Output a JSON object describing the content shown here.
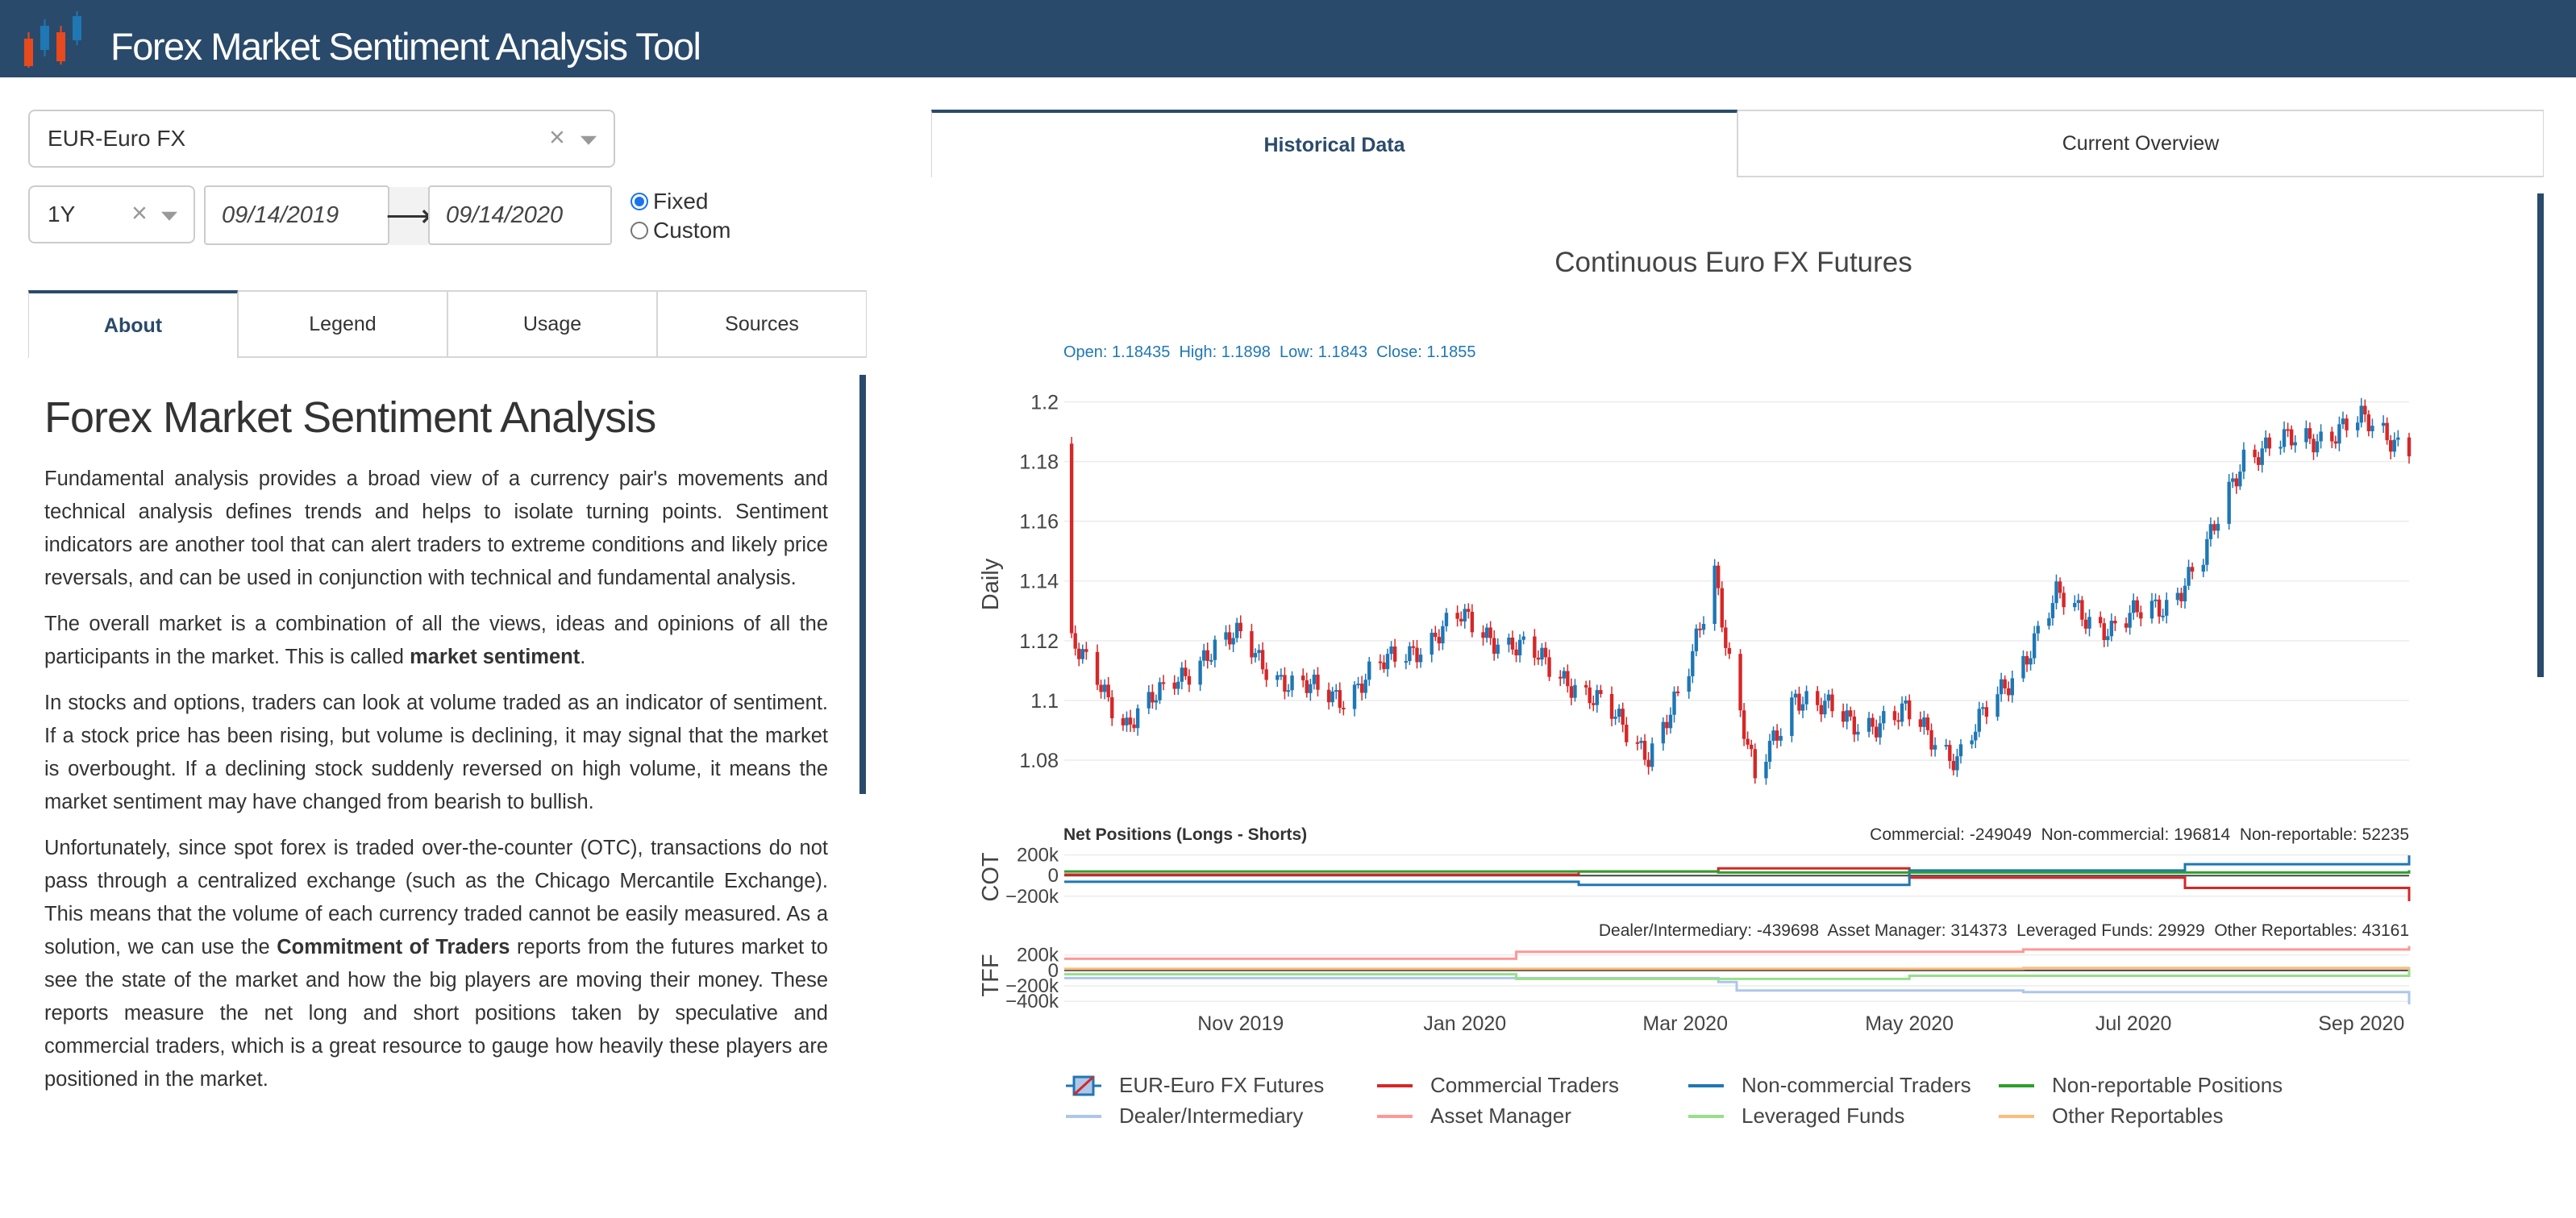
{
  "header": {
    "title": "Forex Market Sentiment Analysis Tool"
  },
  "colors": {
    "header_bg": "#2a4a6b",
    "up_candle": "#1f77b4",
    "down_candle": "#d62728",
    "accent": "#2a4a6b"
  },
  "controls": {
    "currency": "EUR-Euro FX",
    "period": "1Y",
    "start_date": "09/14/2019",
    "end_date": "09/14/2020",
    "radio_fixed": "Fixed",
    "radio_custom": "Custom",
    "selected_radio": "Fixed"
  },
  "left_tabs": [
    "About",
    "Legend",
    "Usage",
    "Sources"
  ],
  "left_active_tab": "About",
  "right_tabs": [
    "Historical Data",
    "Current Overview"
  ],
  "right_active_tab": "Historical Data",
  "about": {
    "heading": "Forex Market Sentiment Analysis",
    "p1": "Fundamental analysis provides a broad view of a currency pair's movements and technical analysis defines trends and helps to isolate turning points. Sentiment indicators are another tool that can alert traders to extreme conditions and likely price reversals, and can be used in conjunction with technical and fundamental analysis.",
    "p2_a": "The overall market is a combination of all the views, ideas and opinions of all the participants in the market. This is called ",
    "p2_b": "market sentiment",
    "p2_c": ".",
    "p3": "In stocks and options, traders can look at volume traded as an indicator of sentiment. If a stock price has been rising, but volume is declining, it may signal that the market is overbought. If a declining stock suddenly reversed on high volume, it means the market sentiment may have changed from bearish to bullish.",
    "p4_a": "Unfortunately, since spot forex is traded over-the-counter (OTC), transactions do not pass through a centralized exchange (such as the Chicago Mercantile Exchange). This means that the volume of each currency traded cannot be easily measured. As a solution, we can use the ",
    "p4_b": "Commitment of Traders",
    "p4_c": " reports from the futures market to see the state of the market and how the big players are moving their money. These reports measure the net long and short positions taken by speculative and commercial traders, which is a great resource to gauge how heavily these players are positioned in the market."
  },
  "chart_data": {
    "type": "line",
    "title": "Continuous Euro FX Futures",
    "ohlc_readout": "Open: 1.18435  High: 1.1898  Low: 1.1843  Close: 1.1855",
    "price_panel": {
      "ylabel": "Daily",
      "yticks": [
        "1.2",
        "1.18",
        "1.16",
        "1.14",
        "1.12",
        "1.1",
        "1.08"
      ],
      "ylim": [
        1.07,
        1.205
      ],
      "close_path": [
        [
          "2019-09-16",
          1.118
        ],
        [
          "2019-10-01",
          1.093
        ],
        [
          "2019-10-10",
          1.101
        ],
        [
          "2019-10-21",
          1.115
        ],
        [
          "2019-11-01",
          1.121
        ],
        [
          "2019-11-15",
          1.104
        ],
        [
          "2019-11-29",
          1.102
        ],
        [
          "2019-12-13",
          1.114
        ],
        [
          "2019-12-31",
          1.127
        ],
        [
          "2020-01-15",
          1.118
        ],
        [
          "2020-01-31",
          1.106
        ],
        [
          "2020-02-20",
          1.083
        ],
        [
          "2020-03-01",
          1.104
        ],
        [
          "2020-03-09",
          1.145
        ],
        [
          "2020-03-13",
          1.114
        ],
        [
          "2020-03-20",
          1.072
        ],
        [
          "2020-03-31",
          1.103
        ],
        [
          "2020-04-15",
          1.092
        ],
        [
          "2020-04-30",
          1.095
        ],
        [
          "2020-05-14",
          1.081
        ],
        [
          "2020-05-31",
          1.112
        ],
        [
          "2020-06-10",
          1.134
        ],
        [
          "2020-06-25",
          1.124
        ],
        [
          "2020-07-10",
          1.133
        ],
        [
          "2020-07-20",
          1.147
        ],
        [
          "2020-07-31",
          1.183
        ],
        [
          "2020-08-15",
          1.187
        ],
        [
          "2020-09-01",
          1.193
        ],
        [
          "2020-09-14",
          1.186
        ]
      ]
    },
    "cot_panel": {
      "title": "Net Positions (Longs - Shorts)",
      "ylabel": "COT",
      "yticks": [
        "200k",
        "0",
        "−200k"
      ],
      "readout": "Commercial: -249049  Non-commercial: 196814  Non-reportable: 52235",
      "series": [
        {
          "name": "Commercial Traders",
          "color": "#d62728",
          "x": [
            "2019-09-14",
            "2020-02-01",
            "2020-03-10",
            "2020-05-01",
            "2020-07-15",
            "2020-09-14"
          ],
          "values": [
            10000,
            40000,
            70000,
            -20000,
            -120000,
            -249049
          ]
        },
        {
          "name": "Non-commercial Traders",
          "color": "#1f77b4",
          "x": [
            "2019-09-14",
            "2020-02-01",
            "2020-03-10",
            "2020-05-01",
            "2020-07-15",
            "2020-09-14"
          ],
          "values": [
            -60000,
            -90000,
            -90000,
            50000,
            110000,
            196814
          ]
        },
        {
          "name": "Non-reportable Positions",
          "color": "#2ca02c",
          "x": [
            "2019-09-14",
            "2020-03-10",
            "2020-09-14"
          ],
          "values": [
            40000,
            30000,
            52235
          ]
        }
      ]
    },
    "tff_panel": {
      "ylabel": "TFF",
      "yticks": [
        "200k",
        "0",
        "−200k",
        "−400k"
      ],
      "readout": "Dealer/Intermediary: -439698  Asset Manager: 314373  Leveraged Funds: 29929  Other Reportables: 43161",
      "series": [
        {
          "name": "Dealer/Intermediary",
          "color": "#aec7e8",
          "x": [
            "2019-09-14",
            "2020-03-10",
            "2020-03-15",
            "2020-06-01",
            "2020-09-14"
          ],
          "values": [
            -100000,
            -150000,
            -260000,
            -280000,
            -439698
          ]
        },
        {
          "name": "Asset Manager",
          "color": "#ff9896",
          "x": [
            "2019-09-14",
            "2020-01-15",
            "2020-06-01",
            "2020-09-14"
          ],
          "values": [
            150000,
            240000,
            270000,
            314373
          ]
        },
        {
          "name": "Leveraged Funds",
          "color": "#98df8a",
          "x": [
            "2019-09-14",
            "2020-01-15",
            "2020-05-01",
            "2020-09-14"
          ],
          "values": [
            -50000,
            -110000,
            -70000,
            29929
          ]
        },
        {
          "name": "Other Reportables",
          "color": "#ffbb78",
          "x": [
            "2019-09-14",
            "2020-06-01",
            "2020-09-14"
          ],
          "values": [
            20000,
            30000,
            43161
          ]
        }
      ]
    },
    "xticks": [
      "Nov 2019",
      "Jan 2020",
      "Mar 2020",
      "May 2020",
      "Jul 2020",
      "Sep 2020"
    ],
    "xtick_dates": [
      "2019-11-01",
      "2020-01-01",
      "2020-03-01",
      "2020-05-01",
      "2020-07-01",
      "2020-09-01"
    ],
    "xlim": [
      "2019-09-14",
      "2020-09-14"
    ],
    "legend_placement": "bottom",
    "legend": [
      {
        "label": "EUR-Euro FX Futures",
        "color": "#1f77b4",
        "kind": "candle"
      },
      {
        "label": "Commercial Traders",
        "color": "#d62728",
        "kind": "line"
      },
      {
        "label": "Non-commercial Traders",
        "color": "#1f77b4",
        "kind": "line"
      },
      {
        "label": "Non-reportable Positions",
        "color": "#2ca02c",
        "kind": "line"
      },
      {
        "label": "Dealer/Intermediary",
        "color": "#aec7e8",
        "kind": "line"
      },
      {
        "label": "Asset Manager",
        "color": "#ff9896",
        "kind": "line"
      },
      {
        "label": "Leveraged Funds",
        "color": "#98df8a",
        "kind": "line"
      },
      {
        "label": "Other Reportables",
        "color": "#ffbb78",
        "kind": "line"
      }
    ]
  }
}
